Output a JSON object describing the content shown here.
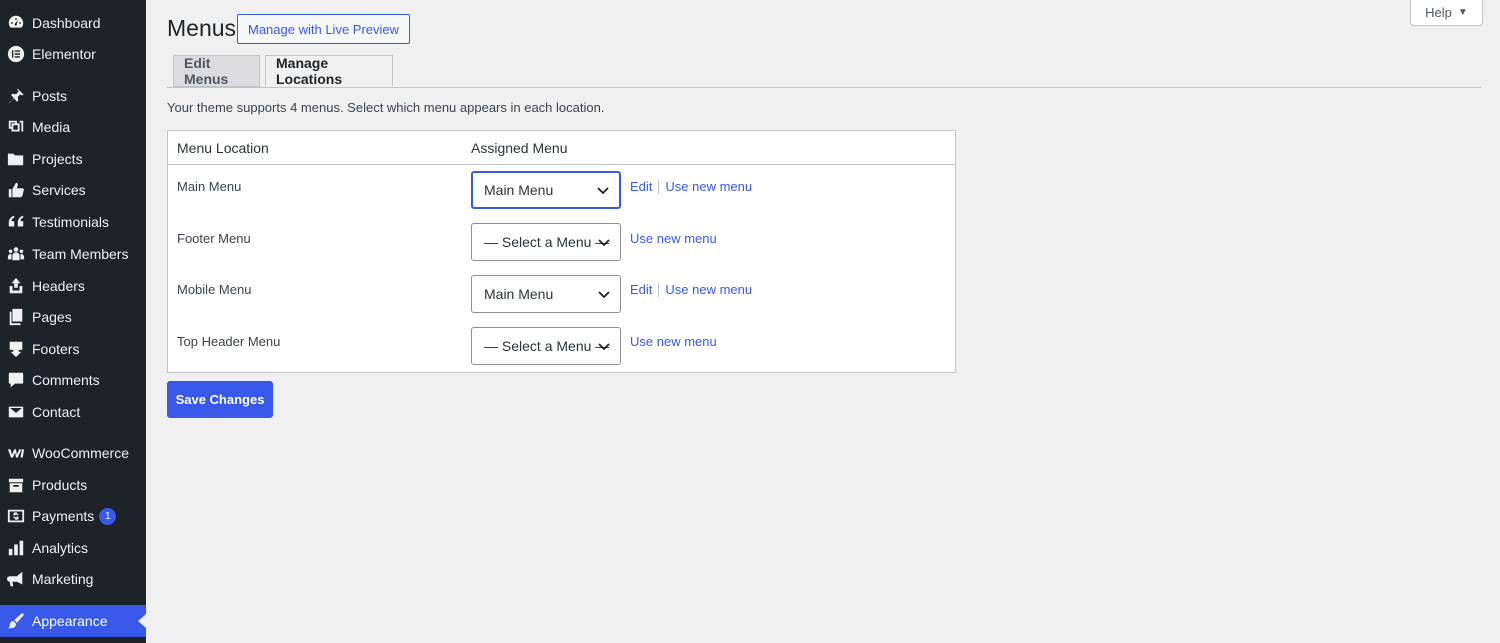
{
  "sidebar": {
    "items": [
      {
        "label": "Dashboard",
        "icon": "dashboard-icon"
      },
      {
        "label": "Elementor",
        "icon": "elementor-icon"
      },
      {
        "label": "Posts",
        "icon": "pushpin-icon"
      },
      {
        "label": "Media",
        "icon": "media-icon"
      },
      {
        "label": "Projects",
        "icon": "folder-icon"
      },
      {
        "label": "Services",
        "icon": "thumbs-up-icon"
      },
      {
        "label": "Testimonials",
        "icon": "quote-icon"
      },
      {
        "label": "Team Members",
        "icon": "groups-icon"
      },
      {
        "label": "Headers",
        "icon": "upload-icon"
      },
      {
        "label": "Pages",
        "icon": "pages-icon"
      },
      {
        "label": "Footers",
        "icon": "download-icon"
      },
      {
        "label": "Comments",
        "icon": "comment-icon"
      },
      {
        "label": "Contact",
        "icon": "email-icon"
      },
      {
        "label": "WooCommerce",
        "icon": "woocommerce-icon"
      },
      {
        "label": "Products",
        "icon": "archive-icon"
      },
      {
        "label": "Payments",
        "icon": "dollar-icon",
        "badge": "1"
      },
      {
        "label": "Analytics",
        "icon": "bar-chart-icon"
      },
      {
        "label": "Marketing",
        "icon": "megaphone-icon"
      },
      {
        "label": "Appearance",
        "icon": "paintbrush-icon",
        "active": true
      }
    ]
  },
  "header": {
    "title": "Menus",
    "live_preview_label": "Manage with Live Preview",
    "help_label": "Help"
  },
  "tabs": [
    {
      "label": "Edit Menus"
    },
    {
      "label": "Manage Locations",
      "active": true
    }
  ],
  "intro_text": "Your theme supports 4 menus. Select which menu appears in each location.",
  "table": {
    "col_location": "Menu Location",
    "col_assigned": "Assigned Menu",
    "rows": [
      {
        "location": "Main Menu",
        "selected": "Main Menu",
        "edit_label": "Edit",
        "new_label": "Use new menu"
      },
      {
        "location": "Footer Menu",
        "selected": "— Select a Menu —",
        "new_label": "Use new menu"
      },
      {
        "location": "Mobile Menu",
        "selected": "Main Menu",
        "edit_label": "Edit",
        "new_label": "Use new menu"
      },
      {
        "location": "Top Header Menu",
        "selected": "— Select a Menu —",
        "new_label": "Use new menu"
      }
    ]
  },
  "save_label": "Save Changes",
  "colors": {
    "accent": "#3858e9",
    "sidebar_bg": "#1d2327",
    "page_bg": "#f0f0f1"
  }
}
